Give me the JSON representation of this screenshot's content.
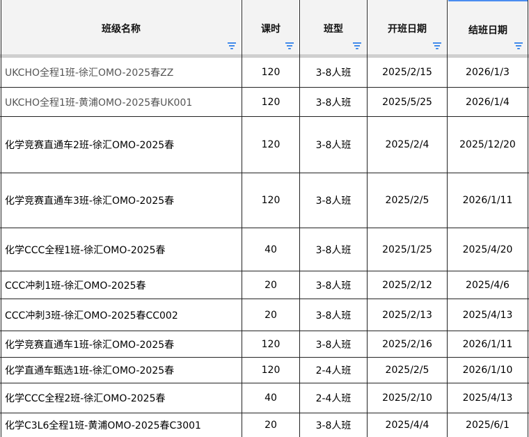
{
  "columns": {
    "name": "班级名称",
    "hours": "课时",
    "type": "班型",
    "start": "开班日期",
    "end": "结班日期"
  },
  "rows": [
    {
      "name": "UKCHO全程1班-徐汇OMO-2025春ZZ",
      "hours": "120",
      "type": "3-8人班",
      "start": "2025/2/15",
      "end": "2026/1/3"
    },
    {
      "name": "UKCHO全程1班-黄浦OMO-2025春UK001",
      "hours": "120",
      "type": "3-8人班",
      "start": "2025/5/25",
      "end": "2026/1/4"
    },
    {
      "name": "化学竞赛直通车2班-徐汇OMO-2025春",
      "hours": "120",
      "type": "3-8人班",
      "start": "2025/2/4",
      "end": "2025/12/20"
    },
    {
      "name": "化学竞赛直通车3班-徐汇OMO-2025春",
      "hours": "120",
      "type": "3-8人班",
      "start": "2025/2/5",
      "end": "2026/1/11"
    },
    {
      "name": "化学CCC全程1班-徐汇OMO-2025春",
      "hours": "40",
      "type": "3-8人班",
      "start": "2025/1/25",
      "end": "2025/4/20"
    },
    {
      "name": "CCC冲刺1班-徐汇OMO-2025春",
      "hours": "20",
      "type": "3-8人班",
      "start": "2025/2/12",
      "end": "2025/4/6"
    },
    {
      "name": "CCC冲刺3班-徐汇OMO-2025春CC002",
      "hours": "20",
      "type": "3-8人班",
      "start": "2025/2/13",
      "end": "2025/4/13"
    },
    {
      "name": "化学竞赛直通车1班-徐汇OMO-2025春",
      "hours": "120",
      "type": "3-8人班",
      "start": "2025/2/16",
      "end": "2026/1/11"
    },
    {
      "name": "化学直通车甄选1班-徐汇OMO-2025春",
      "hours": "120",
      "type": "2-4人班",
      "start": "2025/2/5",
      "end": "2026/1/10"
    },
    {
      "name": "化学CCC全程2班-徐汇OMO-2025春",
      "hours": "40",
      "type": "2-4人班",
      "start": "2025/2/10",
      "end": "2025/4/13"
    },
    {
      "name": "化学C3L6全程1班-黄浦OMO-2025春C3001",
      "hours": "20",
      "type": "3-8人班",
      "start": "2025/4/4",
      "end": "2025/6/1"
    }
  ]
}
